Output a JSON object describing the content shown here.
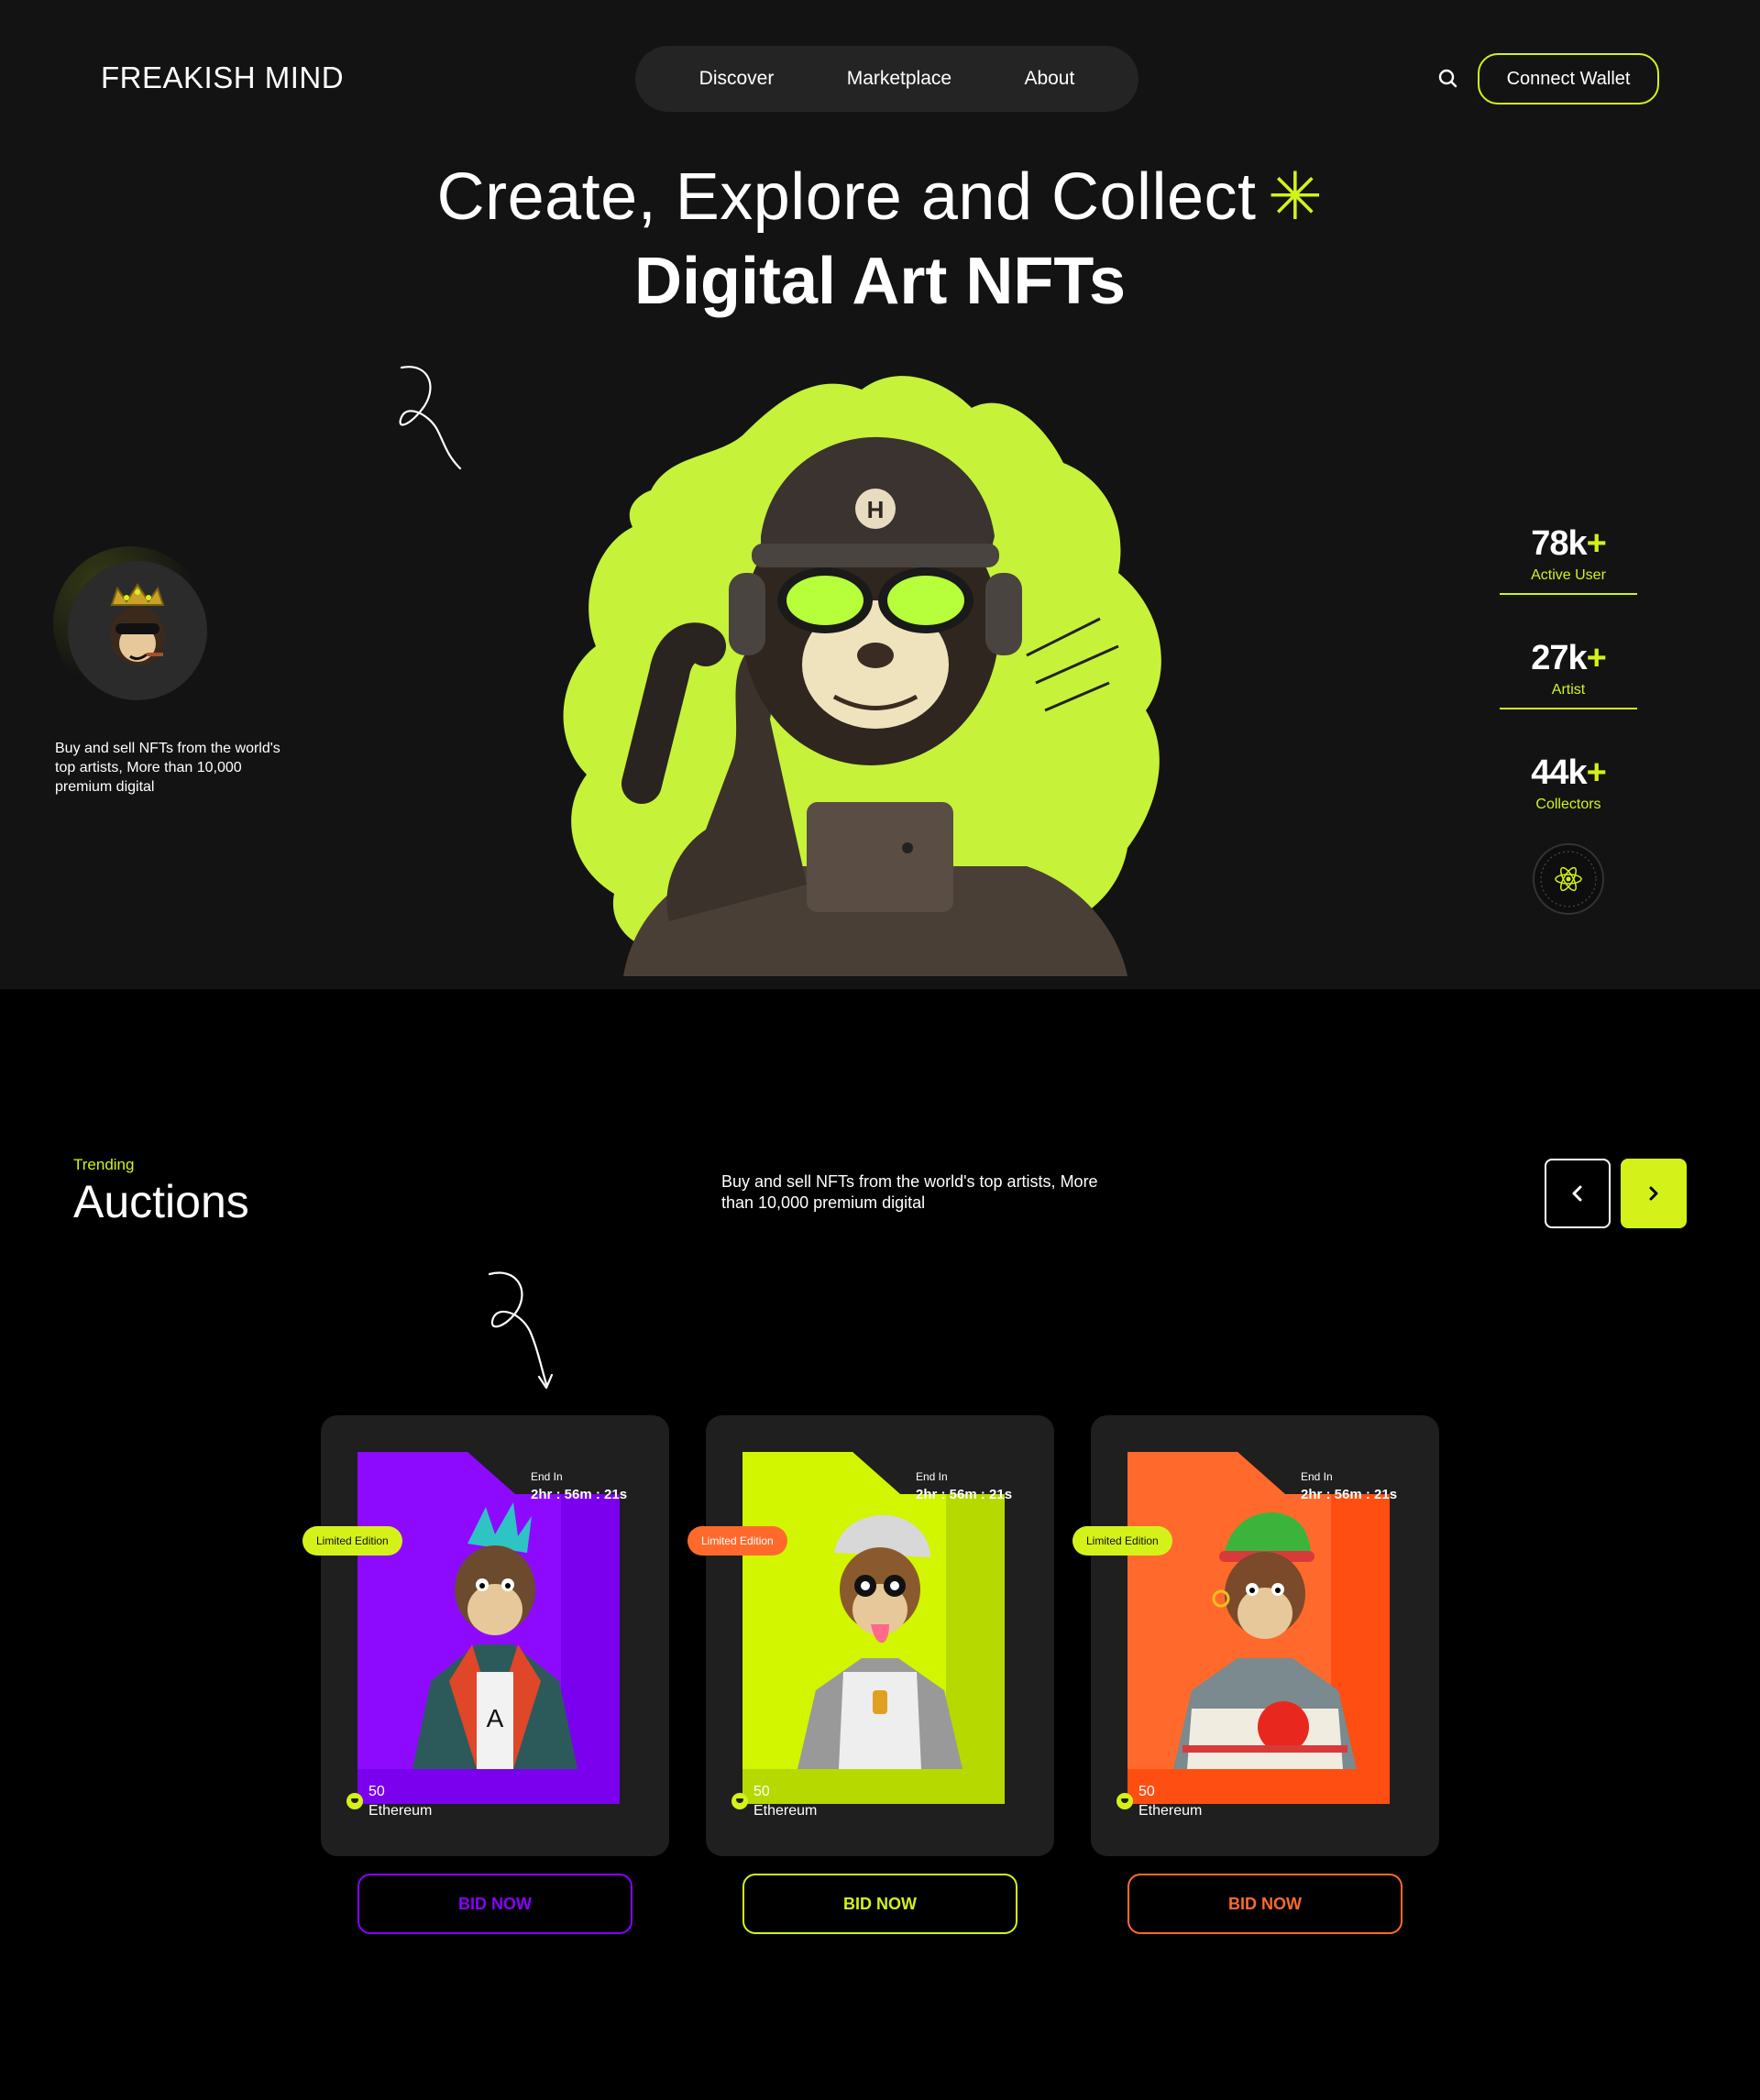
{
  "header": {
    "logo": "FREAKISH MIND",
    "nav": [
      "Discover",
      "Marketplace",
      "About"
    ],
    "connect_label": "Connect Wallet"
  },
  "hero": {
    "headline_line1": "Create, Explore and Collect",
    "headline_line2": "Digital Art NFTs",
    "asterisk": "✳",
    "description": "Buy and sell NFTs from the world's top artists, More than 10,000 premium digital",
    "stats": [
      {
        "value": "78k",
        "plus": "+",
        "label": "Active User"
      },
      {
        "value": "27k",
        "plus": "+",
        "label": "Artist"
      },
      {
        "value": "44k",
        "plus": "+",
        "label": "Collectors"
      }
    ]
  },
  "auctions": {
    "eyebrow": "Trending",
    "title": "Auctions",
    "description": "Buy and sell NFTs from the world's top artists, More than 10,000 premium digital",
    "cards": [
      {
        "end_label": "End In",
        "timer": "2hr : 56m : 21s",
        "badge": "Limited Edition",
        "price": "50",
        "currency": "Ethereum",
        "bid_label": "BID NOW",
        "accent": "#8a00ff",
        "art_bg": "#7a00ee",
        "badge_bg": "#d4f219",
        "badge_color": "#111111"
      },
      {
        "end_label": "End In",
        "timer": "2hr : 56m : 21s",
        "badge": "Limited Edition",
        "price": "50",
        "currency": "Ethereum",
        "bid_label": "BID NOW",
        "accent": "#d4f219",
        "art_bg": "#c6ea00",
        "badge_bg": "#ff6a2c",
        "badge_color": "#ffffff"
      },
      {
        "end_label": "End In",
        "timer": "2hr : 56m : 21s",
        "badge": "Limited Edition",
        "price": "50",
        "currency": "Ethereum",
        "bid_label": "BID NOW",
        "accent": "#ff6a2c",
        "art_bg": "#ff5a1f",
        "badge_bg": "#d4f219",
        "badge_color": "#111111"
      }
    ]
  },
  "colors": {
    "accent": "#d4f219",
    "background": "#000000",
    "hero_bg": "#131313",
    "card_bg": "#1f1f1f"
  }
}
